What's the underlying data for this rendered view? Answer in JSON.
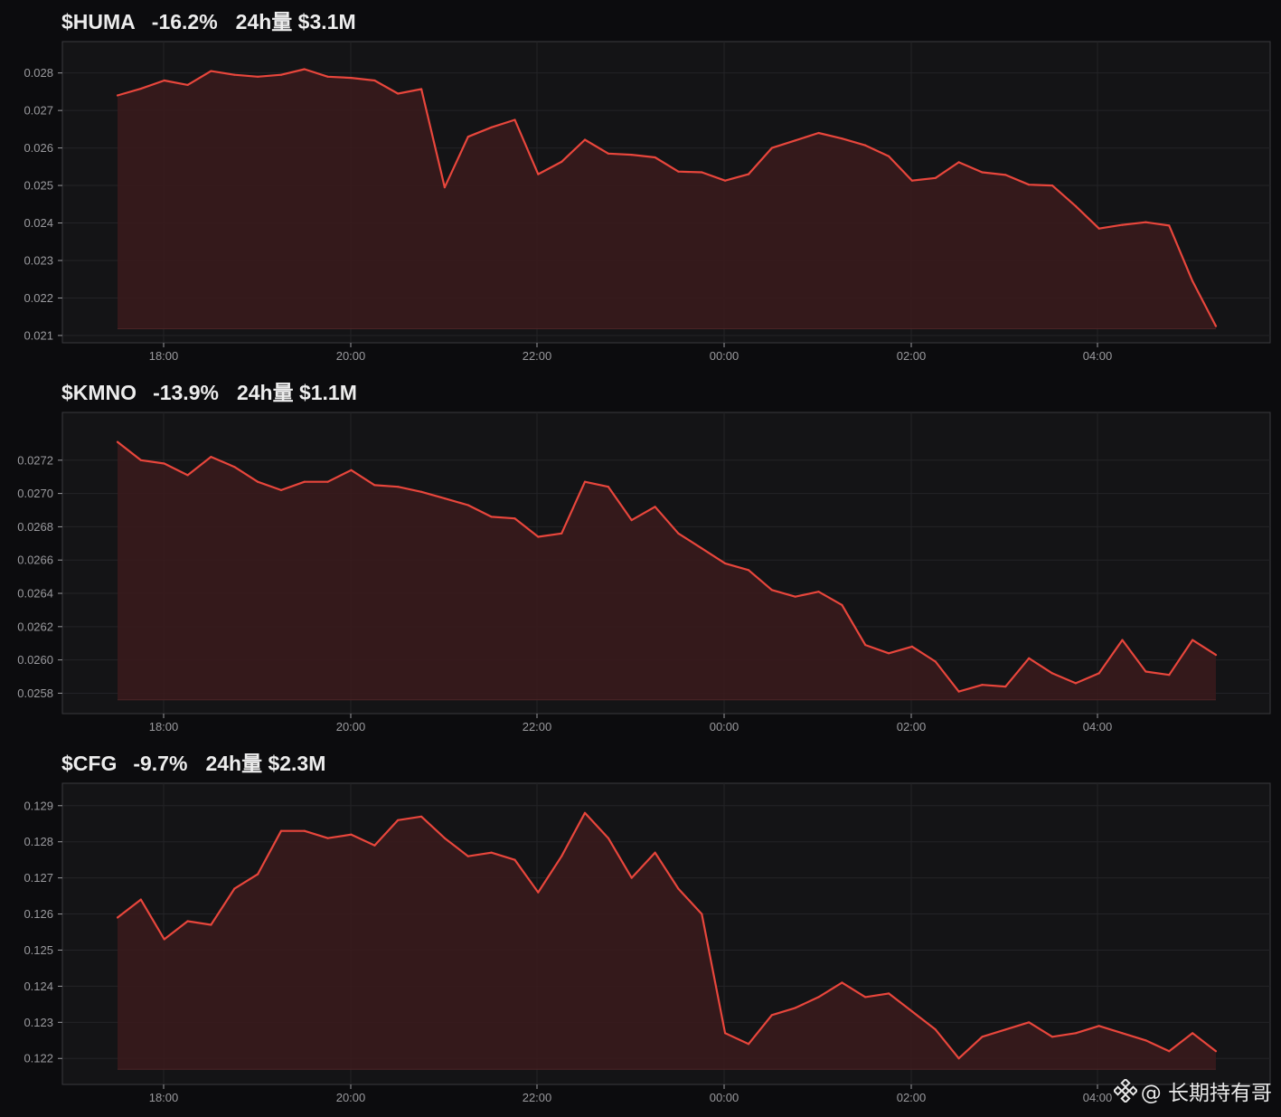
{
  "colors": {
    "background": "#0c0c0e",
    "plot_background": "#141416",
    "line": "#e8463c",
    "fill": "#3a1a1c",
    "grid": "#232327",
    "axis": "#3a3a3e",
    "tick_label": "#9a9a9e",
    "title": "#ededed"
  },
  "x_ticks": [
    "18:00",
    "20:00",
    "22:00",
    "00:00",
    "02:00",
    "04:00"
  ],
  "watermark": {
    "handle": "@ 长期持有哥",
    "icon": "binance-logo-icon"
  },
  "panels": [
    {
      "ticker": "$HUMA",
      "change": "-16.2%",
      "volume": "24h量 $3.1M"
    },
    {
      "ticker": "$KMNO",
      "change": "-13.9%",
      "volume": "24h量 $1.1M"
    },
    {
      "ticker": "$CFG",
      "change": "-9.7%",
      "volume": "24h量 $2.3M"
    }
  ],
  "chart_data": [
    {
      "type": "area",
      "title": "$HUMA  -16.2%  24h量 $3.1M",
      "x_start": "17:30",
      "x_end": "05:15",
      "x_step_minutes": 15,
      "x_ticks": [
        "18:00",
        "20:00",
        "22:00",
        "00:00",
        "02:00",
        "04:00"
      ],
      "ylim": [
        0.02095,
        0.02845
      ],
      "yticks": [
        0.021,
        0.022,
        0.023,
        0.024,
        0.025,
        0.026,
        0.027,
        0.028
      ],
      "y_tick_labels": [
        "0.021",
        "0.022",
        "0.023",
        "0.024",
        "0.025",
        "0.026",
        "0.027",
        "0.028"
      ],
      "baseline": 0.02118,
      "grid": true,
      "values": [
        0.0274,
        0.02758,
        0.0278,
        0.02768,
        0.02805,
        0.02795,
        0.0279,
        0.02795,
        0.0281,
        0.0279,
        0.02787,
        0.0278,
        0.02745,
        0.02757,
        0.02495,
        0.0263,
        0.02655,
        0.02675,
        0.0253,
        0.02563,
        0.02622,
        0.02585,
        0.02582,
        0.02575,
        0.02537,
        0.02535,
        0.02513,
        0.0253,
        0.026,
        0.0262,
        0.0264,
        0.02625,
        0.02607,
        0.02578,
        0.02513,
        0.0252,
        0.02562,
        0.02535,
        0.02528,
        0.02502,
        0.025,
        0.02445,
        0.02385,
        0.02395,
        0.02402,
        0.02393,
        0.02245,
        0.02125
      ]
    },
    {
      "type": "area",
      "title": "$KMNO  -13.9%  24h量 $1.1M",
      "x_start": "17:30",
      "x_end": "05:15",
      "x_step_minutes": 15,
      "x_ticks": [
        "18:00",
        "20:00",
        "22:00",
        "00:00",
        "02:00",
        "04:00"
      ],
      "ylim": [
        0.02571,
        0.0274
      ],
      "yticks": [
        0.0258,
        0.026,
        0.0262,
        0.0264,
        0.0266,
        0.0268,
        0.027,
        0.0272
      ],
      "y_tick_labels": [
        "0.0258",
        "0.0260",
        "0.0262",
        "0.0264",
        "0.0266",
        "0.0268",
        "0.0270",
        "0.0272"
      ],
      "baseline": 0.02576,
      "grid": true,
      "values": [
        0.02731,
        0.0272,
        0.02718,
        0.02711,
        0.02722,
        0.02716,
        0.02707,
        0.02702,
        0.02707,
        0.02707,
        0.02714,
        0.02705,
        0.02704,
        0.02701,
        0.02697,
        0.02693,
        0.02686,
        0.02685,
        0.02674,
        0.02676,
        0.02707,
        0.02704,
        0.02684,
        0.02692,
        0.02676,
        0.02667,
        0.02658,
        0.02654,
        0.02642,
        0.02638,
        0.02641,
        0.02633,
        0.02609,
        0.02604,
        0.02608,
        0.02599,
        0.02581,
        0.02585,
        0.02584,
        0.02601,
        0.02592,
        0.02586,
        0.02592,
        0.02612,
        0.02593,
        0.02591,
        0.02612,
        0.02603
      ]
    },
    {
      "type": "area",
      "title": "$CFG  -9.7%  24h量 $2.3M",
      "x_start": "17:30",
      "x_end": "05:15",
      "x_step_minutes": 15,
      "x_ticks": [
        "18:00",
        "20:00",
        "22:00",
        "00:00",
        "02:00",
        "04:00"
      ],
      "ylim": [
        0.12143,
        0.12922
      ],
      "yticks": [
        0.122,
        0.123,
        0.124,
        0.125,
        0.126,
        0.127,
        0.128,
        0.129
      ],
      "y_tick_labels": [
        "0.122",
        "0.123",
        "0.124",
        "0.125",
        "0.126",
        "0.127",
        "0.128",
        "0.129"
      ],
      "baseline": 0.1217,
      "grid": true,
      "values": [
        0.1259,
        0.1264,
        0.1253,
        0.1258,
        0.1257,
        0.1267,
        0.1271,
        0.1283,
        0.1283,
        0.1281,
        0.1282,
        0.1279,
        0.1286,
        0.1287,
        0.1281,
        0.1276,
        0.1277,
        0.1275,
        0.1266,
        0.1276,
        0.1288,
        0.1281,
        0.127,
        0.1277,
        0.1267,
        0.126,
        0.1227,
        0.1224,
        0.1232,
        0.1234,
        0.1237,
        0.1241,
        0.1237,
        0.1238,
        0.1233,
        0.1228,
        0.122,
        0.1226,
        0.1228,
        0.123,
        0.1226,
        0.1227,
        0.1229,
        0.1227,
        0.1225,
        0.1222,
        0.1227,
        0.1222
      ]
    }
  ]
}
